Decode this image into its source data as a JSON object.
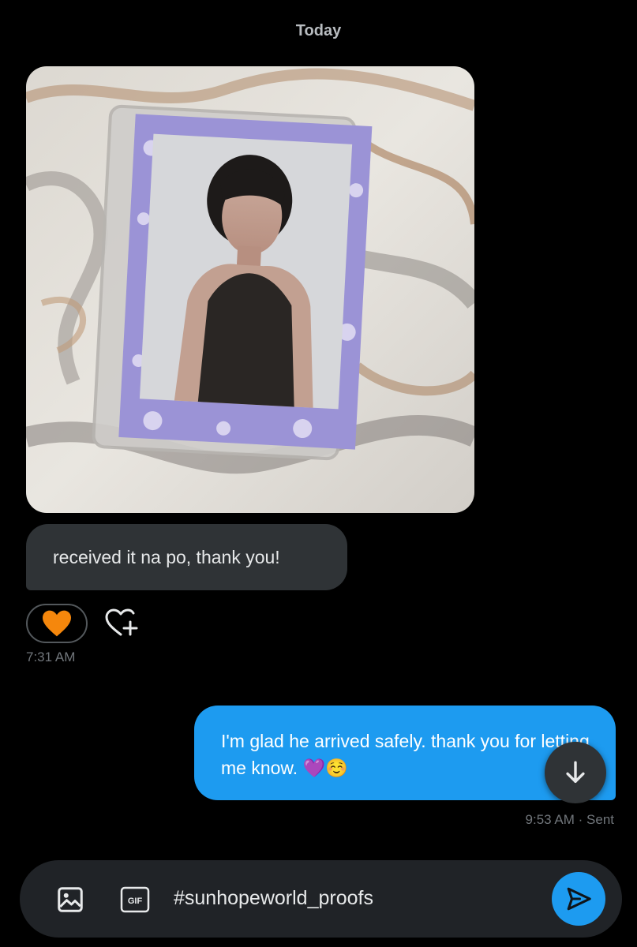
{
  "conversation": {
    "date_separator": "Today"
  },
  "received": {
    "photo_icon": "photocard-image",
    "message": "received it na po, thank you!",
    "reaction_emoji": "🧡",
    "add_reaction_icon": "heart-plus-icon",
    "timestamp": "7:31 AM"
  },
  "sent": {
    "message": "I'm glad he arrived safely. thank you for letting me know. 💜☺️",
    "timestamp": "9:53 AM",
    "status": "Sent",
    "meta": "9:53 AM · Sent"
  },
  "scroll_down_icon": "arrow-down-icon",
  "composer": {
    "media_icon": "image-icon",
    "gif_label": "GIF",
    "input_value": "#sunhopeworld_proofs",
    "send_icon": "send-icon"
  },
  "colors": {
    "background": "#000000",
    "received_bubble": "#2f3336",
    "sent_bubble": "#1d9bf0",
    "muted_text": "#71767b",
    "reaction_heart": "#f5870c"
  }
}
